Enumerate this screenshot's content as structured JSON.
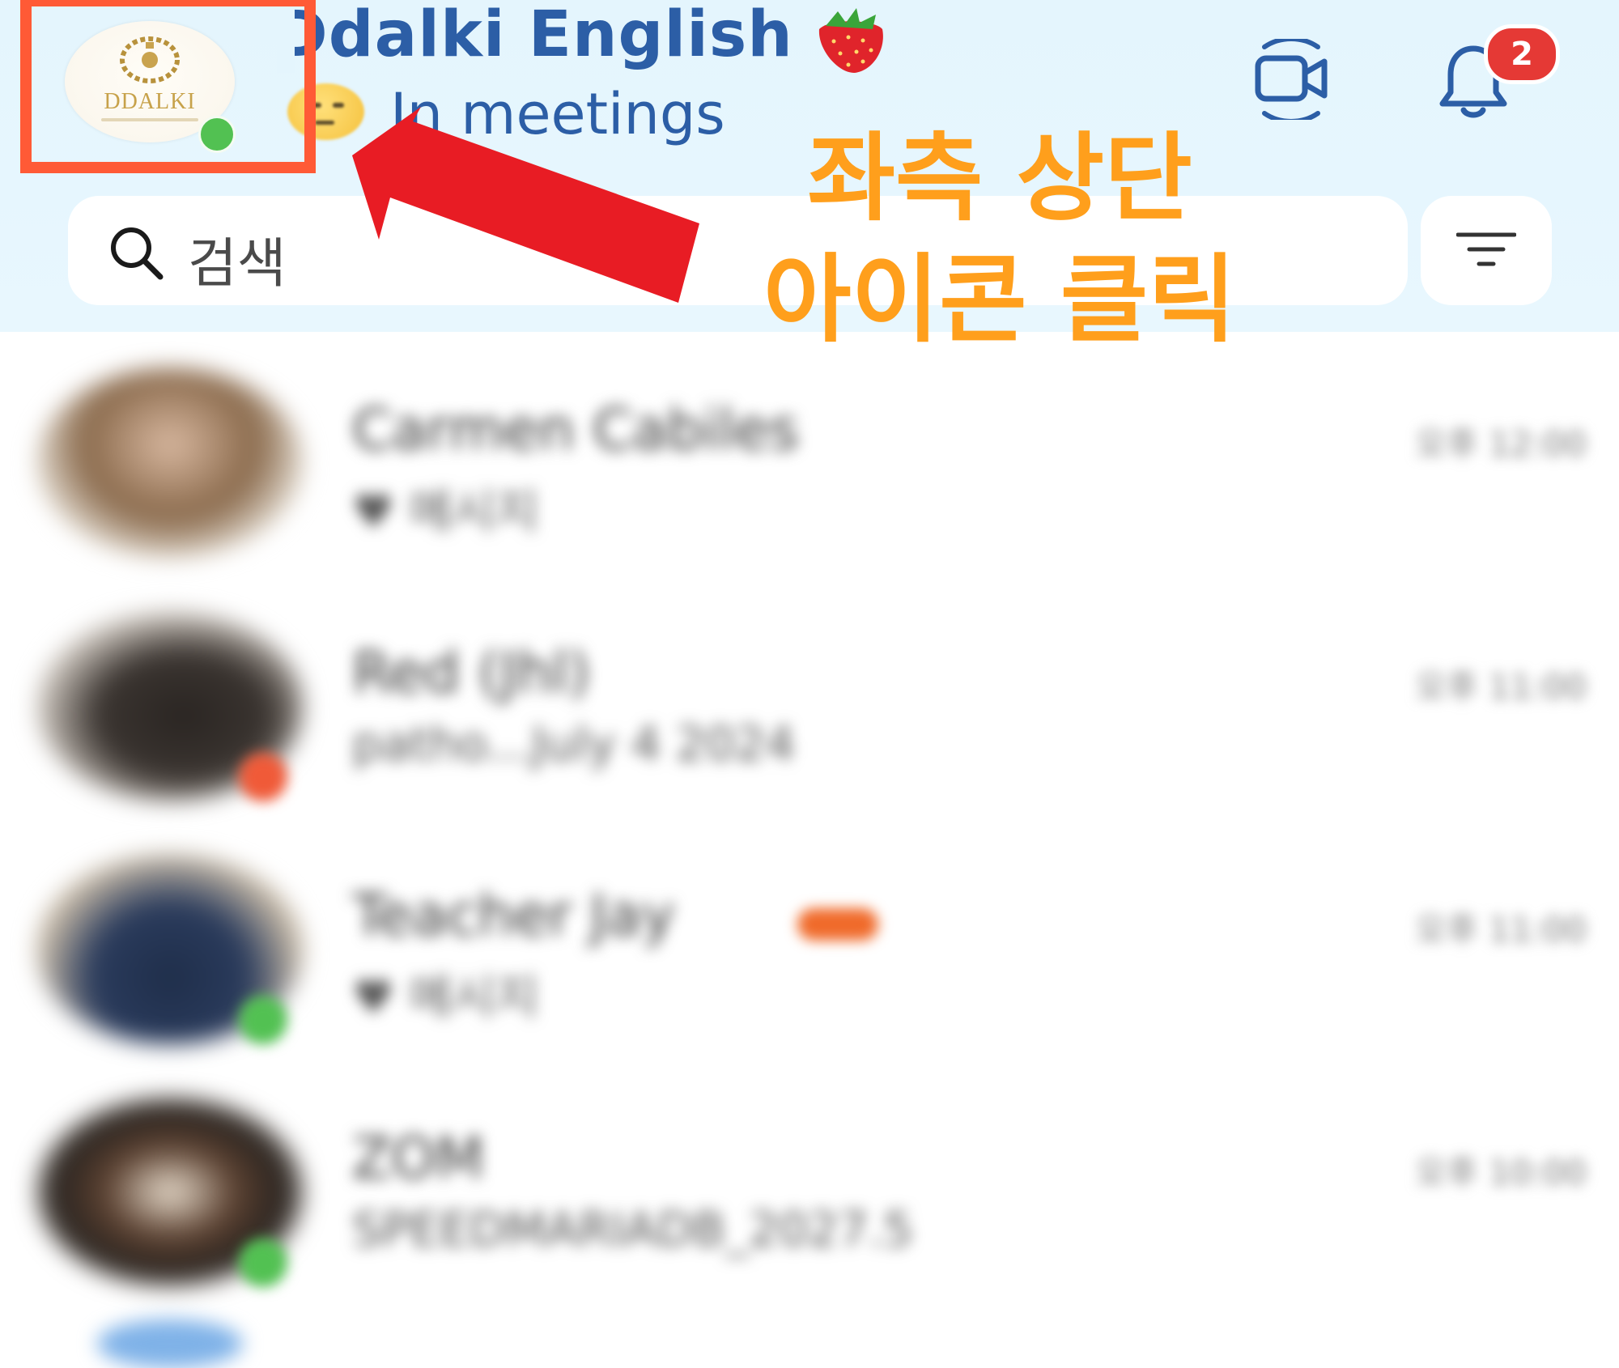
{
  "header": {
    "title": "Ddalki English",
    "status_text": "In meetings",
    "logo_text": "DDALKI",
    "notification_count": "2",
    "search": {
      "placeholder": "검색"
    }
  },
  "annotation": {
    "line1": "좌측 상단",
    "line2": "아이콘 클릭"
  },
  "chats": [
    {
      "name": "Carmen Cabiles",
      "preview": "♥ 메시지",
      "time": "오후 12:00"
    },
    {
      "name": "Red (Jhl)",
      "preview": "patho...July 4 2024",
      "time": "오후 11:00"
    },
    {
      "name": "Teacher Jay",
      "preview": "♥ 메시지",
      "time": "오후 11:00"
    },
    {
      "name": "ZOM",
      "preview": "SPEEDMARIADB_2027.5",
      "time": "오후 10:00"
    }
  ],
  "colors": {
    "header_bg": "#e4f5fd",
    "title_blue": "#2c5ea6",
    "highlight_red": "#ff5a36",
    "arrow_red": "#e81c24",
    "annotation_orange": "#ff9f1c",
    "badge_red": "#e53935",
    "online_green": "#52c152"
  },
  "icons": {
    "video": "video-camera-icon",
    "bell": "bell-icon",
    "search": "search-icon",
    "filter": "filter-icon",
    "strawberry": "strawberry-emoji",
    "status": "neutral-face-emoji"
  }
}
